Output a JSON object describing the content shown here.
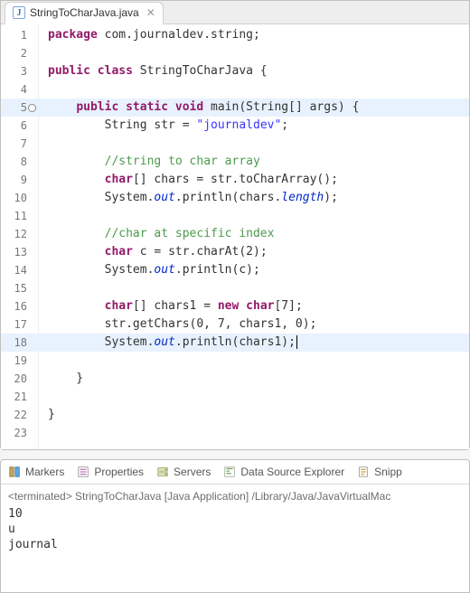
{
  "tab": {
    "filename": "StringToCharJava.java",
    "close_glyph": "✕"
  },
  "code": {
    "lines": [
      {
        "n": 1,
        "segs": [
          {
            "c": "pkg",
            "t": "package "
          },
          {
            "c": "pln",
            "t": "com.journaldev.string;"
          }
        ]
      },
      {
        "n": 2,
        "segs": []
      },
      {
        "n": 3,
        "segs": [
          {
            "c": "kw",
            "t": "public class "
          },
          {
            "c": "pln",
            "t": "StringToCharJava {"
          }
        ]
      },
      {
        "n": 4,
        "segs": []
      },
      {
        "n": 5,
        "hl": true,
        "marked": true,
        "segs": [
          {
            "c": "pln",
            "t": "    "
          },
          {
            "c": "kw",
            "t": "public static void "
          },
          {
            "c": "pln",
            "t": "main(String[] args) {"
          }
        ]
      },
      {
        "n": 6,
        "segs": [
          {
            "c": "pln",
            "t": "        String str = "
          },
          {
            "c": "str",
            "t": "\"journaldev\""
          },
          {
            "c": "pln",
            "t": ";"
          }
        ]
      },
      {
        "n": 7,
        "segs": []
      },
      {
        "n": 8,
        "segs": [
          {
            "c": "pln",
            "t": "        "
          },
          {
            "c": "com",
            "t": "//string to char array"
          }
        ]
      },
      {
        "n": 9,
        "segs": [
          {
            "c": "pln",
            "t": "        "
          },
          {
            "c": "kw",
            "t": "char"
          },
          {
            "c": "pln",
            "t": "[] chars = str.toCharArray();"
          }
        ]
      },
      {
        "n": 10,
        "segs": [
          {
            "c": "pln",
            "t": "        System."
          },
          {
            "c": "fld",
            "t": "out"
          },
          {
            "c": "pln",
            "t": ".println(chars."
          },
          {
            "c": "fld",
            "t": "length"
          },
          {
            "c": "pln",
            "t": ");"
          }
        ]
      },
      {
        "n": 11,
        "segs": []
      },
      {
        "n": 12,
        "segs": [
          {
            "c": "pln",
            "t": "        "
          },
          {
            "c": "com",
            "t": "//char at specific index"
          }
        ]
      },
      {
        "n": 13,
        "segs": [
          {
            "c": "pln",
            "t": "        "
          },
          {
            "c": "kw",
            "t": "char "
          },
          {
            "c": "pln",
            "t": "c = str.charAt(2);"
          }
        ]
      },
      {
        "n": 14,
        "segs": [
          {
            "c": "pln",
            "t": "        System."
          },
          {
            "c": "fld",
            "t": "out"
          },
          {
            "c": "pln",
            "t": ".println(c);"
          }
        ]
      },
      {
        "n": 15,
        "segs": []
      },
      {
        "n": 16,
        "segs": [
          {
            "c": "pln",
            "t": "        "
          },
          {
            "c": "kw",
            "t": "char"
          },
          {
            "c": "pln",
            "t": "[] chars1 = "
          },
          {
            "c": "kw",
            "t": "new char"
          },
          {
            "c": "pln",
            "t": "[7];"
          }
        ]
      },
      {
        "n": 17,
        "segs": [
          {
            "c": "pln",
            "t": "        str.getChars(0, 7, chars1, 0);"
          }
        ]
      },
      {
        "n": 18,
        "hl": true,
        "caret": true,
        "segs": [
          {
            "c": "pln",
            "t": "        System."
          },
          {
            "c": "fld",
            "t": "out"
          },
          {
            "c": "pln",
            "t": ".println(chars1);"
          }
        ]
      },
      {
        "n": 19,
        "segs": []
      },
      {
        "n": 20,
        "segs": [
          {
            "c": "pln",
            "t": "    }"
          }
        ]
      },
      {
        "n": 21,
        "segs": []
      },
      {
        "n": 22,
        "segs": [
          {
            "c": "pln",
            "t": "}"
          }
        ]
      },
      {
        "n": 23,
        "segs": []
      }
    ]
  },
  "views": {
    "tabs": [
      {
        "id": "markers",
        "label": "Markers",
        "icon": "markers"
      },
      {
        "id": "properties",
        "label": "Properties",
        "icon": "properties"
      },
      {
        "id": "servers",
        "label": "Servers",
        "icon": "servers"
      },
      {
        "id": "dse",
        "label": "Data Source Explorer",
        "icon": "dse"
      },
      {
        "id": "snippets",
        "label": "Snipp",
        "icon": "snippets"
      }
    ]
  },
  "console": {
    "header": "<terminated> StringToCharJava [Java Application] /Library/Java/JavaVirtualMac",
    "lines": [
      "10",
      "u",
      "journal"
    ]
  }
}
